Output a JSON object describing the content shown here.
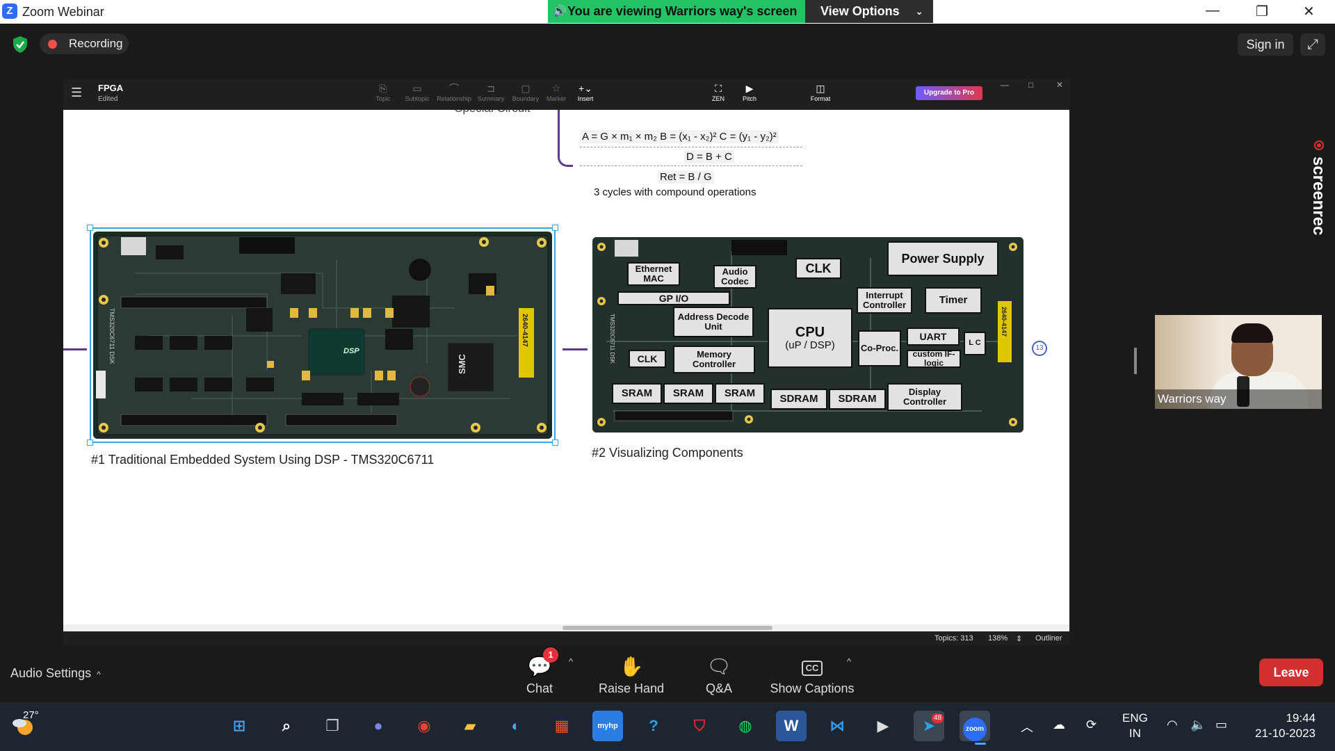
{
  "window": {
    "app_title": "Zoom Webinar",
    "viewing_banner": "You are viewing Warriors way's screen",
    "view_options": "View Options"
  },
  "top": {
    "recording": "Recording",
    "sign_in": "Sign in"
  },
  "app": {
    "file_name": "FPGA",
    "file_status": "Edited",
    "tools": [
      "Topic",
      "Subtopic",
      "Relationship",
      "Summary",
      "Boundary",
      "Marker",
      "Insert",
      "ZEN",
      "Pitch",
      "Format"
    ],
    "upgrade": "Upgrade to Pro",
    "status": {
      "topics": "Topics: 313",
      "zoom": "138%",
      "outliner": "Outliner"
    }
  },
  "mindmap": {
    "parent_topic_partial": "Special Circuit",
    "formula_line1": "A = G × m₁ × m₂  B = (x₁ - x₂)² C = (y₁ - y₂)²",
    "formula_line2": "D = B + C",
    "formula_line3": "Ret = B / G",
    "formula_note": "3 cycles with compound operations",
    "caption1": "#1 Traditional Embedded System Using DSP - TMS320C6711",
    "caption2": "#2 Visualizing Components",
    "collapsed_count": "13"
  },
  "board1": {
    "chip_dsp": "DSP",
    "chip_smc": "SMC",
    "side_label": "TMS320C6711 DSK",
    "sticker": "2640-4147"
  },
  "board2": {
    "blocks": {
      "ethernet": "Ethernet MAC",
      "audio": "Audio Codec",
      "clk_top": "CLK",
      "power": "Power Supply",
      "gpio": "GP I/O",
      "address": "Address Decode Unit",
      "interrupt": "Interrupt Controller",
      "timer": "Timer",
      "cpu": "CPU",
      "cpu_sub": "(uP / DSP)",
      "coproc": "Co-Proc.",
      "uart": "UART",
      "lc": "L C",
      "clk_left": "CLK",
      "memctrl": "Memory Controller",
      "custom": "custom IF-logic",
      "sram1": "SRAM",
      "sram2": "SRAM",
      "sram3": "SRAM",
      "sdram1": "SDRAM",
      "sdram2": "SDRAM",
      "display": "Display Controller"
    },
    "side_label": "TMS320C6711 DSK",
    "sticker": "2640-4147"
  },
  "video": {
    "name": "Warriors way"
  },
  "overlay": {
    "screenrec": "screenrec"
  },
  "controls": {
    "audio_settings": "Audio Settings",
    "chat": "Chat",
    "chat_badge": "1",
    "raise_hand": "Raise Hand",
    "qa": "Q&A",
    "captions": "Show Captions",
    "captions_icon": "CC",
    "leave": "Leave"
  },
  "taskbar": {
    "temperature": "27°",
    "lang1": "ENG",
    "lang2": "IN",
    "time": "19:44",
    "date": "21-10-2023",
    "telegram_badge": "48",
    "zoom_label": "zoom",
    "hp_label": "myhp"
  },
  "colors": {
    "zoom_blue": "#2d6cf5",
    "banner_green": "#23c264",
    "leave_red": "#d23030",
    "selection_blue": "#3aa5e0",
    "branch_purple": "#5b3a8f"
  }
}
